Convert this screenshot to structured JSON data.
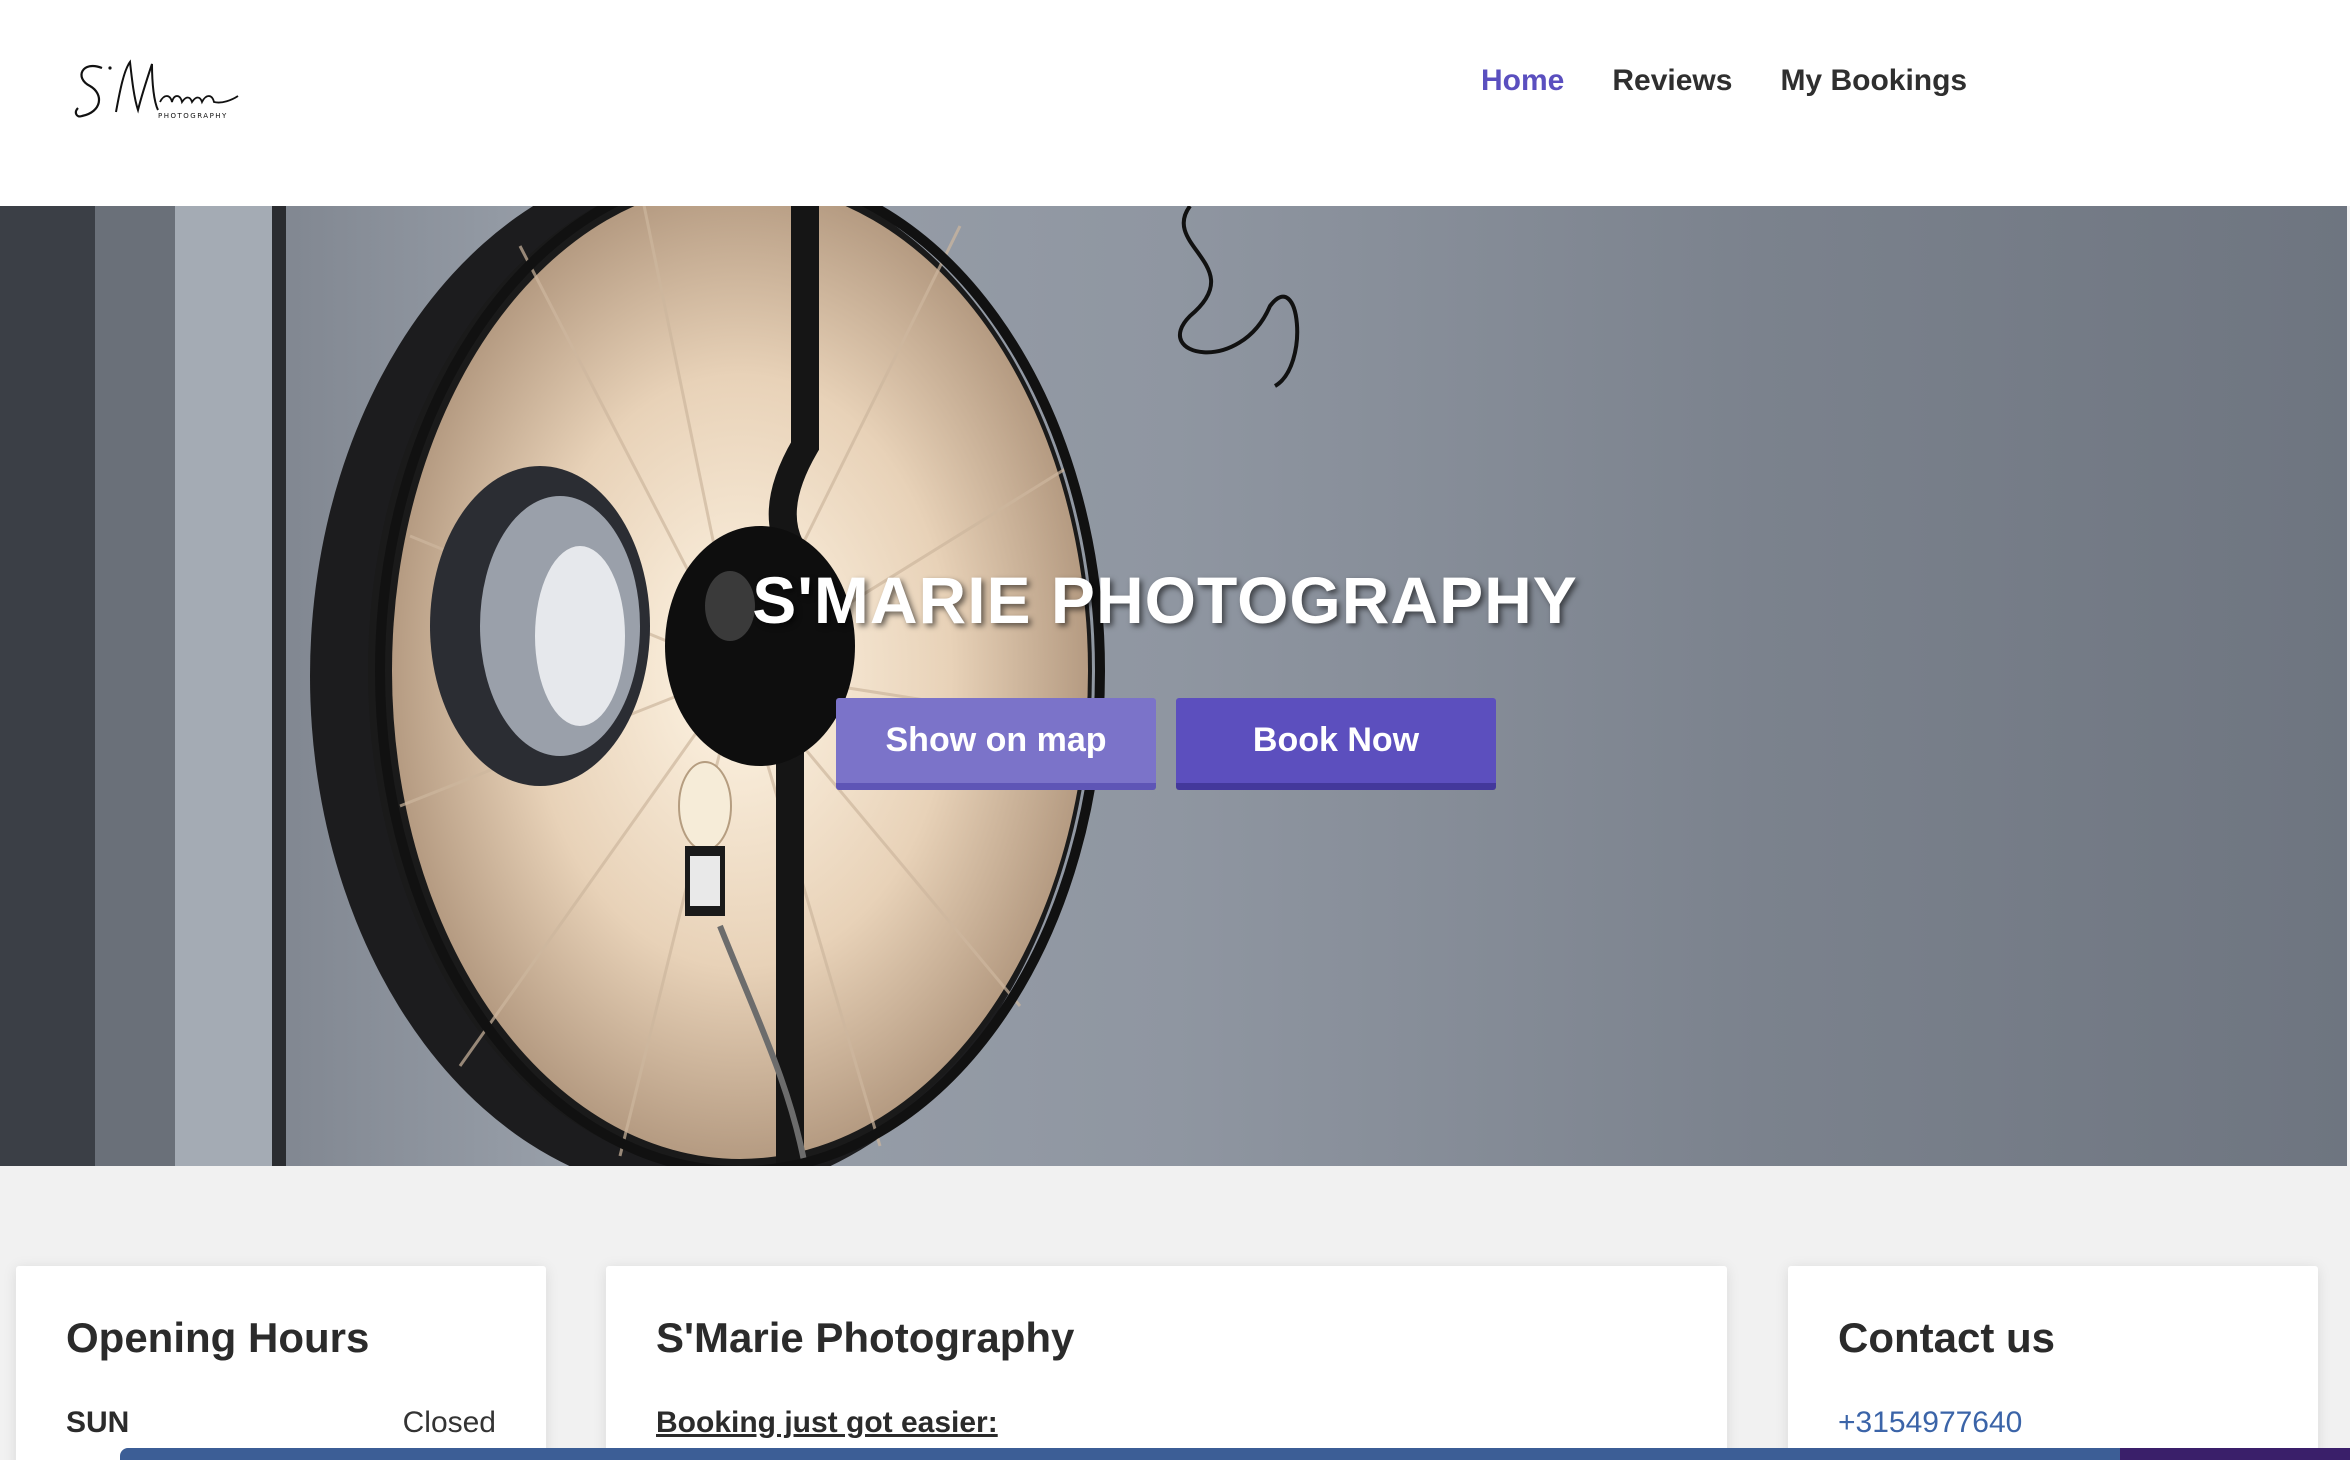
{
  "brand": {
    "logo_text": "S'Marie",
    "logo_subtext": "PHOTOGRAPHY"
  },
  "nav": {
    "items": [
      {
        "label": "Home",
        "active": true
      },
      {
        "label": "Reviews",
        "active": false
      },
      {
        "label": "My Bookings",
        "active": false
      }
    ]
  },
  "hero": {
    "title": "S'MARIE PHOTOGRAPHY",
    "show_on_map_label": "Show on map",
    "book_now_label": "Book Now"
  },
  "opening_hours": {
    "title": "Opening Hours",
    "rows": [
      {
        "day": "SUN",
        "hours": "Closed"
      }
    ]
  },
  "about": {
    "title": "S'Marie Photography",
    "subtitle": "Booking just got easier:"
  },
  "contact": {
    "title": "Contact us",
    "phone": "+3154977640"
  },
  "colors": {
    "accent": "#5a4fbf",
    "button_map": "#7b73c9",
    "button_book": "#5c4fbe",
    "link": "#3b64a8"
  }
}
